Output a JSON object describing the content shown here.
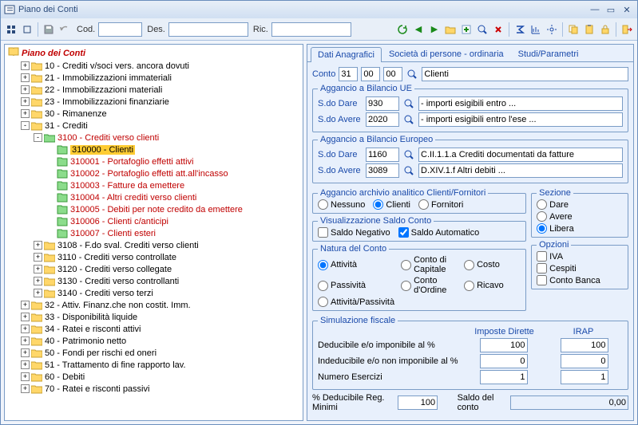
{
  "window": {
    "title": "Piano dei Conti"
  },
  "toolbar": {
    "cod_label": "Cod.",
    "des_label": "Des.",
    "ric_label": "Ric."
  },
  "tree_title": "Piano dei Conti",
  "tree": [
    {
      "exp": "+",
      "label": "10 - Crediti v/soci vers. ancora dovuti",
      "cls": ""
    },
    {
      "exp": "+",
      "label": "21 - Immobilizzazioni immateriali",
      "cls": ""
    },
    {
      "exp": "+",
      "label": "22 - Immobilizzazioni materiali",
      "cls": ""
    },
    {
      "exp": "+",
      "label": "23 - Immobilizzazioni finanziarie",
      "cls": ""
    },
    {
      "exp": "+",
      "label": "30 - Rimanenze",
      "cls": ""
    },
    {
      "exp": "-",
      "label": "31 - Crediti",
      "cls": ""
    }
  ],
  "tree_3100": {
    "exp": "-",
    "label": "3100 - Crediti verso clienti",
    "cls": "red"
  },
  "leaves": [
    {
      "label": "310000 - Clienti",
      "sel": true
    },
    {
      "label": "310001 - Portafoglio effetti attivi"
    },
    {
      "label": "310002 - Portafoglio effetti att.all'incasso"
    },
    {
      "label": "310003 - Fatture  da emettere"
    },
    {
      "label": "310004 - Altri crediti verso clienti"
    },
    {
      "label": "310005 - Debiti per note credito da emettere"
    },
    {
      "label": "310006 - Clienti c/anticipi"
    },
    {
      "label": "310007 - Clienti esteri"
    }
  ],
  "tree_after": [
    {
      "exp": "+",
      "label": "3108 - F.do sval. Crediti verso clienti"
    },
    {
      "exp": "+",
      "label": "3110 - Crediti verso controllate"
    },
    {
      "exp": "+",
      "label": "3120 - Crediti verso collegate"
    },
    {
      "exp": "+",
      "label": "3130 - Crediti verso controllanti"
    },
    {
      "exp": "+",
      "label": "3140 - Crediti verso terzi"
    }
  ],
  "tree_end": [
    {
      "exp": "+",
      "label": "32 - Attiv. Finanz.che non costit. Imm."
    },
    {
      "exp": "+",
      "label": "33 - Disponibilità liquide"
    },
    {
      "exp": "+",
      "label": "34 - Ratei e risconti attivi"
    },
    {
      "exp": "+",
      "label": "40 - Patrimonio netto"
    },
    {
      "exp": "+",
      "label": "50 - Fondi per rischi ed oneri"
    },
    {
      "exp": "+",
      "label": "51 - Trattamento di fine rapporto lav."
    },
    {
      "exp": "+",
      "label": "60 - Debiti"
    },
    {
      "exp": "+",
      "label": "70 - Ratei e risconti passivi"
    }
  ],
  "tabs": {
    "t1": "Dati Anagrafici",
    "t2": "Società di persone - ordinaria",
    "t3": "Studi/Parametri"
  },
  "form": {
    "conto_label": "Conto",
    "conto_a": "31",
    "conto_b": "00",
    "conto_c": "00",
    "conto_desc": "Clienti",
    "ue_legend": "Aggancio a Bilancio UE",
    "sdo_dare": "S.do Dare",
    "sdo_avere": "S.do Avere",
    "ue_dare_val": "930",
    "ue_dare_desc": "- importi esigibili entro ...",
    "ue_avere_val": "2020",
    "ue_avere_desc": "- importi esigibili entro l'ese ...",
    "eu_legend": "Aggancio a  Bilancio Europeo",
    "eu_dare_val": "1160",
    "eu_dare_desc": "C.II.1.1.a Crediti documentati da fatture",
    "eu_avere_val": "3089",
    "eu_avere_desc": "D.XIV.1.f Altri debiti ...",
    "analitico_legend": "Aggancio archivio analitico Clienti/Fornitori",
    "r_nessuno": "Nessuno",
    "r_clienti": "Clienti",
    "r_fornitori": "Fornitori",
    "vis_legend": "Visualizzazione Saldo Conto",
    "c_saldoneg": "Saldo Negativo",
    "c_saldoauto": "Saldo Automatico",
    "natura_legend": "Natura del Conto",
    "n_att": "Attività",
    "n_capitale": "Conto di Capitale",
    "n_costo": "Costo",
    "n_pass": "Passività",
    "n_ordine": "Conto d'Ordine",
    "n_ricavo": "Ricavo",
    "n_attpass": "Attività/Passività",
    "sezione_legend": "Sezione",
    "s_dare": "Dare",
    "s_avere": "Avere",
    "s_libera": "Libera",
    "opzioni_legend": "Opzioni",
    "o_iva": "IVA",
    "o_cespiti": "Cespiti",
    "o_banca": "Conto Banca",
    "sim_legend": "Simulazione fiscale",
    "sim_hdr1": "Imposte Dirette",
    "sim_hdr2": "IRAP",
    "sim_r1": "Deducibile e/o imponibile al %",
    "sim_r1_a": "100",
    "sim_r1_b": "100",
    "sim_r2": "Indeducibile e/o non imponibile al %",
    "sim_r2_a": "0",
    "sim_r2_b": "0",
    "sim_r3": "Numero Esercizi",
    "sim_r3_a": "1",
    "sim_r3_b": "1",
    "footer_lbl": "% Deducibile Reg. Minimi",
    "footer_val": "100",
    "saldo_lbl": "Saldo del conto",
    "saldo_val": "0,00"
  }
}
